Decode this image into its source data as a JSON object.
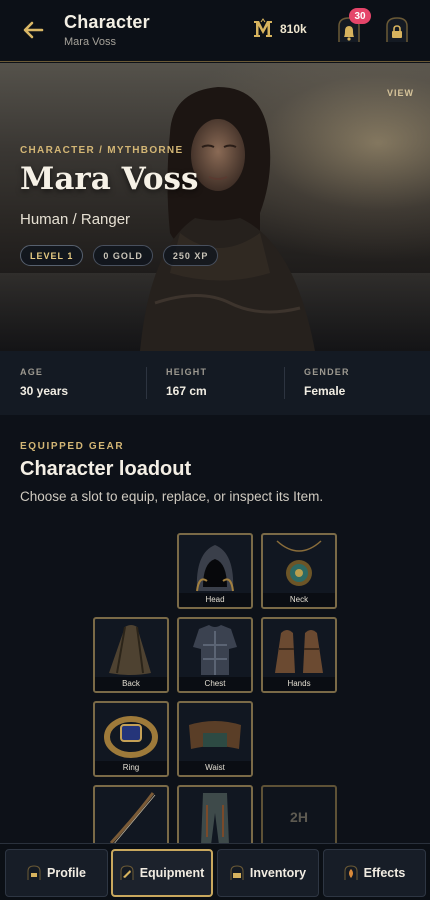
{
  "header": {
    "title": "Character",
    "subtitle": "Mara Voss",
    "currency_amount": "810k",
    "notification_count": "30",
    "currency_icon": "mythborne-m-icon"
  },
  "hero": {
    "view_label": "VIEW",
    "breadcrumb": "CHARACTER / MYTHBORNE",
    "name": "Mara Voss",
    "race_class": "Human / Ranger",
    "pills": [
      "LEVEL 1",
      "0 GOLD",
      "250 XP"
    ]
  },
  "stats": [
    {
      "label": "AGE",
      "value": "30 years"
    },
    {
      "label": "HEIGHT",
      "value": "167 cm"
    },
    {
      "label": "GENDER",
      "value": "Female"
    }
  ],
  "loadout": {
    "eyebrow": "EQUIPPED GEAR",
    "title": "Character loadout",
    "description": "Choose a slot to equip, replace, or inspect its Item.",
    "slots": [
      {
        "label": "Head",
        "icon": "hood-icon"
      },
      {
        "label": "Neck",
        "icon": "amulet-icon"
      },
      {
        "label": "Back",
        "icon": "cloak-icon"
      },
      {
        "label": "Chest",
        "icon": "armor-icon"
      },
      {
        "label": "Hands",
        "icon": "gauntlets-icon"
      },
      {
        "label": "Ring",
        "icon": "ring-icon"
      },
      {
        "label": "Waist",
        "icon": "belt-icon"
      },
      {
        "label": "",
        "icon": "bow-icon"
      },
      {
        "label": "",
        "icon": "leggings-icon"
      },
      {
        "label": "2H",
        "icon": "empty-slot"
      }
    ]
  },
  "nav": {
    "items": [
      {
        "label": "Profile",
        "icon": "lock-icon"
      },
      {
        "label": "Equipment",
        "icon": "lock-icon"
      },
      {
        "label": "Inventory",
        "icon": "lock-icon"
      },
      {
        "label": "Effects",
        "icon": "lock-icon"
      }
    ],
    "active": "Equipment"
  },
  "colors": {
    "accent_gold": "#c9a85e",
    "badge_pink": "#e5456a",
    "background": "#0d1118"
  }
}
